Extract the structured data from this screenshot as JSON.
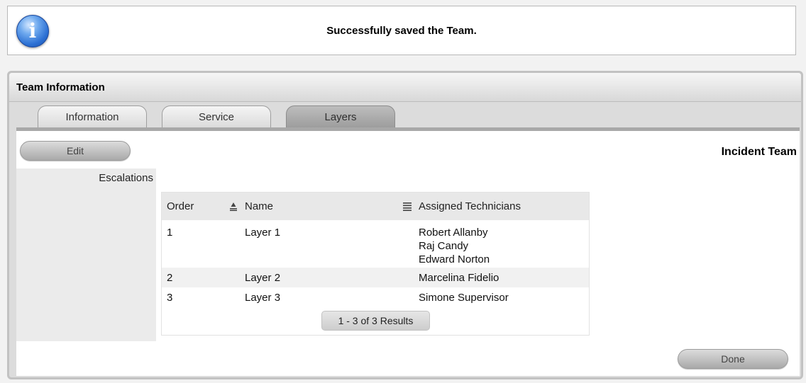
{
  "message": {
    "icon": "info-icon",
    "icon_glyph": "i",
    "text": "Successfully saved the Team."
  },
  "panel": {
    "title": "Team Information",
    "tabs": [
      {
        "label": "Information",
        "active": false
      },
      {
        "label": "Service",
        "active": false
      },
      {
        "label": "Layers",
        "active": true
      }
    ],
    "edit_label": "Edit",
    "team_name": "Incident Team",
    "section_label": "Escalations",
    "done_label": "Done"
  },
  "table": {
    "columns": [
      "Order",
      "Name",
      "Assigned Technicians"
    ],
    "rows": [
      {
        "order": "1",
        "name": "Layer 1",
        "technicians": [
          "Robert Allanby",
          "Raj Candy",
          "Edward Norton"
        ]
      },
      {
        "order": "2",
        "name": "Layer 2",
        "technicians": [
          "Marcelina Fidelio"
        ]
      },
      {
        "order": "3",
        "name": "Layer 3",
        "technicians": [
          "Simone Supervisor"
        ]
      }
    ],
    "results_text": "1 - 3 of 3 Results"
  }
}
